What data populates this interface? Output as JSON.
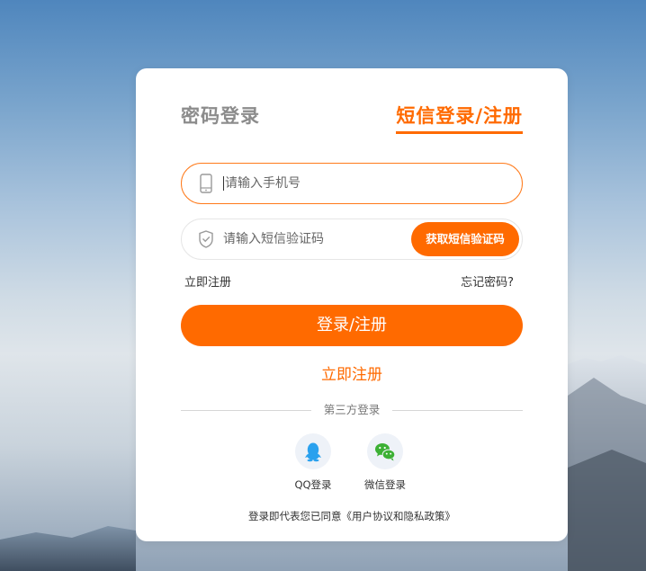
{
  "tabs": {
    "password_login": "密码登录",
    "sms_login": "短信登录/注册"
  },
  "phone_field": {
    "placeholder": "请输入手机号",
    "icon": "phone-icon"
  },
  "code_field": {
    "placeholder": "请输入短信验证码",
    "icon": "shield-icon",
    "get_code_button": "获取短信验证码"
  },
  "links": {
    "register_now": "立即注册",
    "forgot_password": "忘记密码?"
  },
  "submit_button": "登录/注册",
  "register_link_big": "立即注册",
  "third_party": {
    "divider_label": "第三方登录",
    "qq_label": "QQ登录",
    "wechat_label": "微信登录"
  },
  "agreement_text": "登录即代表您已同意《用户协议和隐私政策》",
  "colors": {
    "accent": "#ff6a00",
    "inactive_tab": "#8c8c8c",
    "qq_blue": "#2aa1ee",
    "wechat_green": "#3cb034"
  }
}
